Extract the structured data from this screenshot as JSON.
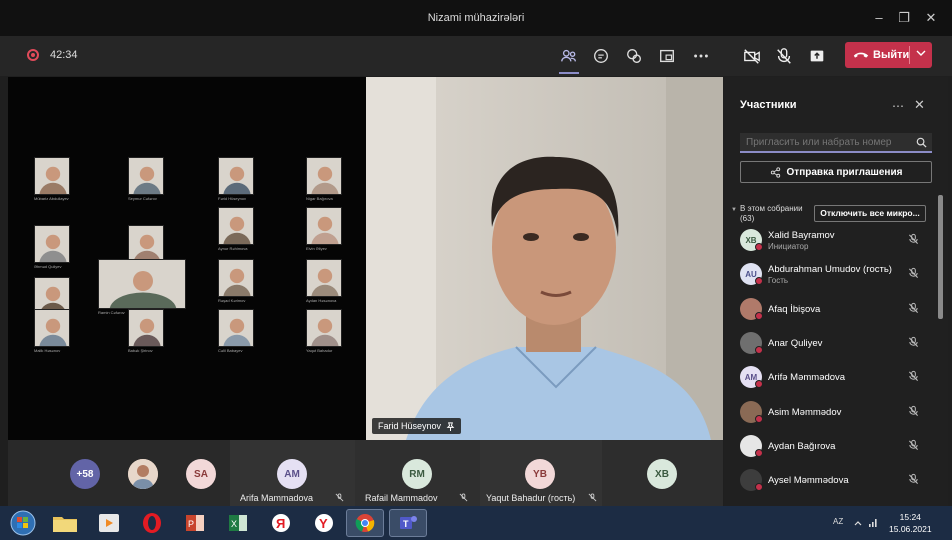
{
  "window": {
    "title": "Nizami mühazirələri"
  },
  "toolbar": {
    "timer": "42:34",
    "leave_label": "Выйти"
  },
  "gallery": {
    "tiles": [
      {
        "name": "Mübariz Abdullayev"
      },
      {
        "name": "Seymur Cəfərov"
      },
      {
        "name": "Fərid Hüseynov"
      },
      {
        "name": "Nigar Bağırova"
      },
      {
        "name": "Əhməd Quliyev"
      },
      {
        "name": "Vüsal Məmmədov"
      },
      {
        "name": "Aynur Rəhimova"
      },
      {
        "name": "Elvin Əliyev"
      },
      {
        "name": "Səbinə Kərimova"
      },
      {
        "name": "Ramin Cəfərov"
      },
      {
        "name": "Rəşad Kərimov"
      },
      {
        "name": "Aydan Həsənova"
      },
      {
        "name": "Malik Həsənov"
      },
      {
        "name": "Babək Şirinov"
      },
      {
        "name": "Cəlil Babayev"
      },
      {
        "name": "Yaqut Bahadur"
      }
    ]
  },
  "speaker": {
    "name": "Farid Hüseynov"
  },
  "strip": {
    "overflow": "+58",
    "initials_sa": "SA",
    "people": [
      {
        "initials": "AM",
        "name": "Arifa Mammadova"
      },
      {
        "initials": "RM",
        "name": "Rafail Mammadov"
      },
      {
        "initials": "YB",
        "name": "Yaqut Bahadur (гость)"
      },
      {
        "initials": "XB",
        "name": ""
      }
    ]
  },
  "panel": {
    "title": "Участники",
    "search_placeholder": "Пригласить или набрать номер",
    "invite_label": "Отправка приглашения",
    "section_label": "В этом собрании",
    "section_count": "(63)",
    "mute_all_label": "Отключить все микро...",
    "participants": [
      {
        "initials": "XB",
        "name": "Xalid Bayramov",
        "role": "Инициатор",
        "avatar_color": "#d9e8dc",
        "text_color": "#3a5a40"
      },
      {
        "initials": "AU",
        "name": "Abdurahman Umudov (гость)",
        "role": "Гость",
        "avatar_color": "#dfe2f2",
        "text_color": "#4a4f8a"
      },
      {
        "initials": "",
        "name": "Afaq İbişova",
        "role": "",
        "avatar_color": "#b07a6a",
        "text_color": "#fff"
      },
      {
        "initials": "",
        "name": "Anar Quliyev",
        "role": "",
        "avatar_color": "#6f6f6f",
        "text_color": "#fff"
      },
      {
        "initials": "AM",
        "name": "Arifə Məmmədova",
        "role": "",
        "avatar_color": "#e5e0f3",
        "text_color": "#5a4f8a"
      },
      {
        "initials": "",
        "name": "Asim Məmmədov",
        "role": "",
        "avatar_color": "#8a6a55",
        "text_color": "#fff"
      },
      {
        "initials": "",
        "name": "Aydan Bağırova",
        "role": "",
        "avatar_color": "#e6e6e6",
        "text_color": "#333"
      },
      {
        "initials": "",
        "name": "Aysel Məmmədova",
        "role": "",
        "avatar_color": "#3d3d3d",
        "text_color": "#fff"
      }
    ]
  },
  "taskbar": {
    "lang": "AZ",
    "time": "15:24",
    "date": "15.06.2021"
  }
}
